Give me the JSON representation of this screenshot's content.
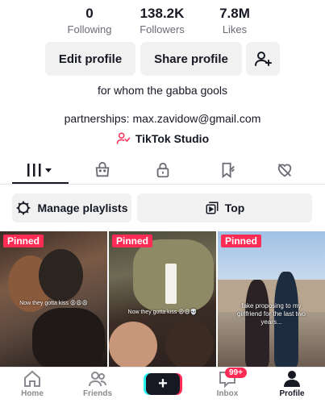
{
  "stats": {
    "following": {
      "value": "0",
      "label": "Following"
    },
    "followers": {
      "value": "138.2K",
      "label": "Followers"
    },
    "likes": {
      "value": "7.8M",
      "label": "Likes"
    }
  },
  "buttons": {
    "edit_profile": "Edit profile",
    "share_profile": "Share profile"
  },
  "bio": {
    "text": "for whom the gabba gools",
    "partnerships": "partnerships: max.zavidow@gmail.com",
    "studio": "TikTok Studio"
  },
  "actions": {
    "playlists": "Manage playlists",
    "top": "Top"
  },
  "videos": [
    {
      "badge": "Pinned",
      "caption": "Now they gotta kiss 😩😩😩"
    },
    {
      "badge": "Pinned",
      "caption": "Now they gotta kiss 😩😩💀"
    },
    {
      "badge": "Pinned",
      "caption": "fake proposing to my girlfriend for the last two years..."
    }
  ],
  "nav": {
    "home": "Home",
    "friends": "Friends",
    "inbox": "Inbox",
    "inbox_badge": "99+",
    "profile": "Profile"
  },
  "colors": {
    "accent": "#fe2c55",
    "cyan": "#25f4ee",
    "text": "#161823",
    "muted": "#6b6d75",
    "button_bg": "#f1f1f2"
  }
}
